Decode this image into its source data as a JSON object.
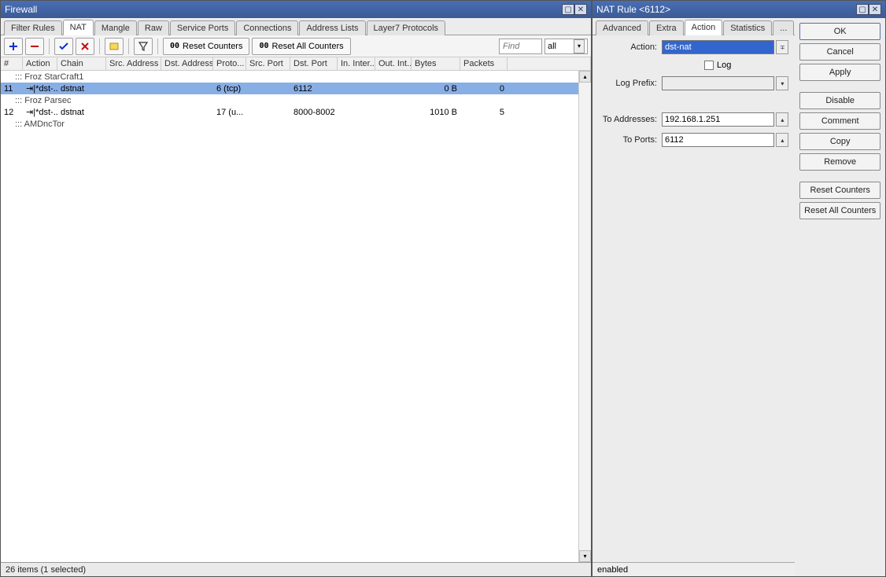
{
  "left_window": {
    "title": "Firewall",
    "tabs": [
      "Filter Rules",
      "NAT",
      "Mangle",
      "Raw",
      "Service Ports",
      "Connections",
      "Address Lists",
      "Layer7 Protocols"
    ],
    "active_tab": "NAT",
    "toolbar": {
      "reset_counters": "Reset Counters",
      "reset_all_counters": "Reset All Counters"
    },
    "find_placeholder": "Find",
    "filter_value": "all",
    "columns": [
      "#",
      "Action",
      "Chain",
      "Src. Address",
      "Dst. Address",
      "Proto...",
      "Src. Port",
      "Dst. Port",
      "In. Inter...",
      "Out. Int...",
      "Bytes",
      "Packets"
    ],
    "groups": [
      {
        "label": "::: Froz StarCraft1",
        "rows": [
          {
            "num": "11",
            "action": "⇥|*dst-...",
            "chain": "dstnat",
            "src": "",
            "dst": "",
            "proto": "6 (tcp)",
            "sport": "",
            "dport": "6112",
            "inif": "",
            "outif": "",
            "bytes": "0 B",
            "packets": "0",
            "selected": true
          }
        ]
      },
      {
        "label": "::: Froz Parsec",
        "rows": [
          {
            "num": "12",
            "action": "⇥|*dst-...",
            "chain": "dstnat",
            "src": "",
            "dst": "",
            "proto": "17 (u...",
            "sport": "",
            "dport": "8000-8002",
            "inif": "",
            "outif": "",
            "bytes": "1010 B",
            "packets": "5",
            "selected": false
          }
        ]
      },
      {
        "label": "::: AMDncTor",
        "rows": []
      }
    ],
    "status": "26 items (1 selected)"
  },
  "right_window": {
    "title": "NAT Rule <6112>",
    "tabs": [
      "Advanced",
      "Extra",
      "Action",
      "Statistics",
      "..."
    ],
    "active_tab": "Action",
    "form": {
      "action_label": "Action:",
      "action_value": "dst-nat",
      "log_label": "Log",
      "log_prefix_label": "Log Prefix:",
      "log_prefix_value": "",
      "to_addresses_label": "To Addresses:",
      "to_addresses_value": "192.168.1.251",
      "to_ports_label": "To Ports:",
      "to_ports_value": "6112"
    },
    "buttons": [
      "OK",
      "Cancel",
      "Apply",
      "Disable",
      "Comment",
      "Copy",
      "Remove",
      "Reset Counters",
      "Reset All Counters"
    ],
    "status": "enabled"
  },
  "col_widths": {
    "num": 28,
    "action": 44,
    "chain": 62,
    "src": 70,
    "dst": 66,
    "proto": 42,
    "sport": 56,
    "dport": 60,
    "inif": 48,
    "outif": 46,
    "bytes": 62,
    "packets": 60
  }
}
